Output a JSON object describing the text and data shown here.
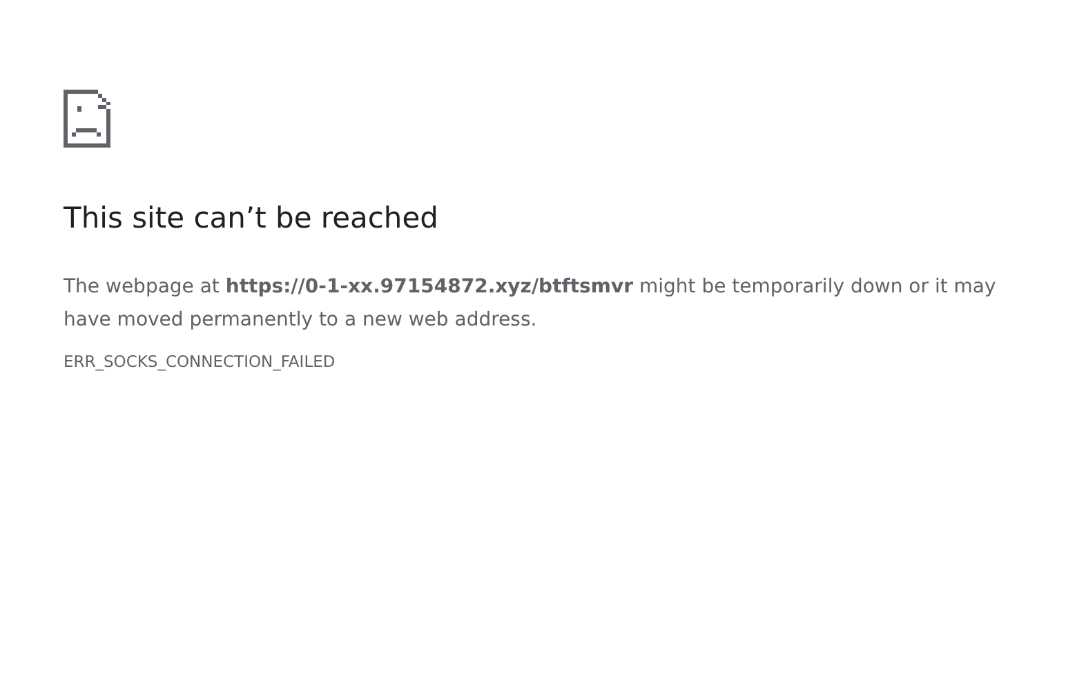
{
  "heading": "This site can’t be reached",
  "message": "The webpage at **https://0-1-xx.97154872.xyz/btftsmvr** might be temporarily down or it may have moved permanently to a new web address.",
  "error_code": "ERR_SOCKS_CONNECTION_FAILED"
}
